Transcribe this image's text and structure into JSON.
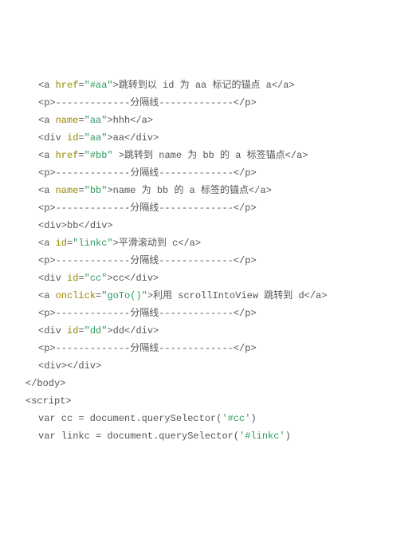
{
  "lines": [
    {
      "ind": 2,
      "parts": [
        {
          "c": "tag",
          "t": "<a "
        },
        {
          "c": "attr-name",
          "t": "href"
        },
        {
          "c": "tag",
          "t": "="
        },
        {
          "c": "attr-val",
          "t": "\"#aa\""
        },
        {
          "c": "tag",
          "t": ">"
        },
        {
          "c": "text",
          "t": "跳转到以 id 为 aa 标记的锚点 a"
        },
        {
          "c": "tag",
          "t": "</a>"
        }
      ]
    },
    {
      "ind": 2,
      "parts": [
        {
          "c": "tag",
          "t": "<p>"
        },
        {
          "c": "text",
          "t": "-------------分隔线-------------"
        },
        {
          "c": "tag",
          "t": "</p>"
        }
      ]
    },
    {
      "ind": 2,
      "parts": [
        {
          "c": "tag",
          "t": "<a "
        },
        {
          "c": "attr-name",
          "t": "name"
        },
        {
          "c": "tag",
          "t": "="
        },
        {
          "c": "attr-val",
          "t": "\"aa\""
        },
        {
          "c": "tag",
          "t": ">"
        },
        {
          "c": "text",
          "t": "hhh"
        },
        {
          "c": "tag",
          "t": "</a>"
        }
      ]
    },
    {
      "ind": 2,
      "parts": [
        {
          "c": "tag",
          "t": "<div "
        },
        {
          "c": "attr-name",
          "t": "id"
        },
        {
          "c": "tag",
          "t": "="
        },
        {
          "c": "attr-val",
          "t": "\"aa\""
        },
        {
          "c": "tag",
          "t": ">"
        },
        {
          "c": "text",
          "t": "aa"
        },
        {
          "c": "tag",
          "t": "</div>"
        }
      ]
    },
    {
      "ind": 2,
      "parts": [
        {
          "c": "tag",
          "t": "<a "
        },
        {
          "c": "attr-name",
          "t": "href"
        },
        {
          "c": "tag",
          "t": "="
        },
        {
          "c": "attr-val",
          "t": "\"#bb\""
        },
        {
          "c": "tag",
          "t": " >"
        },
        {
          "c": "text",
          "t": "跳转到 name 为 bb 的 a 标签锚点"
        },
        {
          "c": "tag",
          "t": "</a>"
        }
      ]
    },
    {
      "ind": 2,
      "parts": [
        {
          "c": "tag",
          "t": "<p>"
        },
        {
          "c": "text",
          "t": "-------------分隔线-------------"
        },
        {
          "c": "tag",
          "t": "</p>"
        }
      ]
    },
    {
      "ind": 2,
      "parts": [
        {
          "c": "tag",
          "t": "<a "
        },
        {
          "c": "attr-name",
          "t": "name"
        },
        {
          "c": "tag",
          "t": "="
        },
        {
          "c": "attr-val",
          "t": "\"bb\""
        },
        {
          "c": "tag",
          "t": ">"
        },
        {
          "c": "text",
          "t": "name 为 bb 的 a 标签的锚点"
        },
        {
          "c": "tag",
          "t": "</a>"
        }
      ]
    },
    {
      "ind": 2,
      "parts": [
        {
          "c": "tag",
          "t": "<p>"
        },
        {
          "c": "text",
          "t": "-------------分隔线-------------"
        },
        {
          "c": "tag",
          "t": "</p>"
        }
      ]
    },
    {
      "ind": 2,
      "parts": [
        {
          "c": "tag",
          "t": "<div>"
        },
        {
          "c": "text",
          "t": "bb"
        },
        {
          "c": "tag",
          "t": "</div>"
        }
      ]
    },
    {
      "ind": 2,
      "parts": [
        {
          "c": "tag",
          "t": "<a "
        },
        {
          "c": "attr-name",
          "t": "id"
        },
        {
          "c": "tag",
          "t": "="
        },
        {
          "c": "attr-val",
          "t": "\"linkc\""
        },
        {
          "c": "tag",
          "t": ">"
        },
        {
          "c": "text",
          "t": "平滑滚动到 c"
        },
        {
          "c": "tag",
          "t": "</a>"
        }
      ]
    },
    {
      "ind": 2,
      "parts": [
        {
          "c": "tag",
          "t": "<p>"
        },
        {
          "c": "text",
          "t": "-------------分隔线-------------"
        },
        {
          "c": "tag",
          "t": "</p>"
        }
      ]
    },
    {
      "ind": 2,
      "parts": [
        {
          "c": "tag",
          "t": "<div "
        },
        {
          "c": "attr-name",
          "t": "id"
        },
        {
          "c": "tag",
          "t": "="
        },
        {
          "c": "attr-val",
          "t": "\"cc\""
        },
        {
          "c": "tag",
          "t": ">"
        },
        {
          "c": "text",
          "t": "cc"
        },
        {
          "c": "tag",
          "t": "</div>"
        }
      ]
    },
    {
      "ind": 2,
      "parts": [
        {
          "c": "tag",
          "t": "<a "
        },
        {
          "c": "attr-name",
          "t": "onclick"
        },
        {
          "c": "tag",
          "t": "="
        },
        {
          "c": "attr-val",
          "t": "\"goTo()\""
        },
        {
          "c": "tag",
          "t": ">"
        },
        {
          "c": "text",
          "t": "利用 scrollIntoView 跳转到 d"
        },
        {
          "c": "tag",
          "t": "</a>"
        }
      ]
    },
    {
      "ind": 2,
      "parts": [
        {
          "c": "tag",
          "t": "<p>"
        },
        {
          "c": "text",
          "t": "-------------分隔线-------------"
        },
        {
          "c": "tag",
          "t": "</p>"
        }
      ]
    },
    {
      "ind": 2,
      "parts": [
        {
          "c": "tag",
          "t": "<div "
        },
        {
          "c": "attr-name",
          "t": "id"
        },
        {
          "c": "tag",
          "t": "="
        },
        {
          "c": "attr-val",
          "t": "\"dd\""
        },
        {
          "c": "tag",
          "t": ">"
        },
        {
          "c": "text",
          "t": "dd"
        },
        {
          "c": "tag",
          "t": "</div>"
        }
      ]
    },
    {
      "ind": 2,
      "parts": [
        {
          "c": "tag",
          "t": "<p>"
        },
        {
          "c": "text",
          "t": "-------------分隔线-------------"
        },
        {
          "c": "tag",
          "t": "</p>"
        }
      ]
    },
    {
      "ind": 2,
      "parts": [
        {
          "c": "tag",
          "t": "<div></div>"
        }
      ]
    },
    {
      "ind": 1,
      "parts": [
        {
          "c": "tag",
          "t": "</body>"
        }
      ]
    },
    {
      "ind": 1,
      "parts": [
        {
          "c": "tag",
          "t": "<script>"
        }
      ]
    },
    {
      "ind": 2,
      "parts": [
        {
          "c": "text",
          "t": "var cc = document.querySelector("
        },
        {
          "c": "attr-val",
          "t": "'#cc'"
        },
        {
          "c": "text",
          "t": ")"
        }
      ]
    },
    {
      "ind": 2,
      "parts": [
        {
          "c": "text",
          "t": "var linkc = document.querySelector("
        },
        {
          "c": "attr-val",
          "t": "'#linkc'"
        },
        {
          "c": "text",
          "t": ")"
        }
      ]
    }
  ]
}
